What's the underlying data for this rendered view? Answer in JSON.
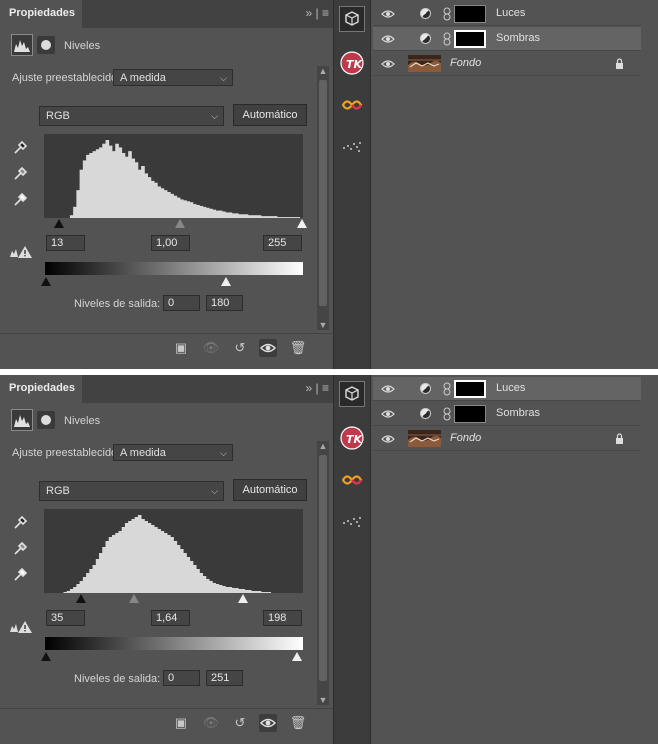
{
  "panels": [
    {
      "tab_title": "Propiedades",
      "adjustment_name": "Niveles",
      "preset_label": "Ajuste preestablecido:",
      "preset_value": "A medida",
      "channel": "RGB",
      "auto_label": "Automático",
      "input_levels": {
        "black": "13",
        "gamma": "1,00",
        "white": "255"
      },
      "output_label": "Niveles de salida:",
      "output_levels": {
        "black": "0",
        "white": "180"
      },
      "histogram": [
        0,
        0,
        0,
        0,
        0,
        0,
        0,
        0,
        3,
        12,
        30,
        52,
        62,
        68,
        70,
        72,
        74,
        76,
        80,
        84,
        78,
        72,
        80,
        76,
        70,
        66,
        72,
        64,
        60,
        52,
        56,
        48,
        44,
        40,
        38,
        34,
        32,
        30,
        28,
        26,
        24,
        22,
        20,
        19,
        18,
        17,
        15,
        14,
        13,
        12,
        11,
        10,
        9,
        8,
        8,
        7,
        6,
        6,
        5,
        5,
        4,
        4,
        4,
        3,
        3,
        3,
        3,
        2,
        2,
        2,
        2,
        2,
        1,
        1,
        1,
        1,
        1,
        1,
        1,
        0
      ],
      "layers": [
        {
          "name": "Luces",
          "type": "adjustment",
          "selected": false
        },
        {
          "name": "Sombras",
          "type": "adjustment",
          "selected": true
        },
        {
          "name": "Fondo",
          "type": "background",
          "selected": false
        }
      ]
    },
    {
      "tab_title": "Propiedades",
      "adjustment_name": "Niveles",
      "preset_label": "Ajuste preestablecido:",
      "preset_value": "A medida",
      "channel": "RGB",
      "auto_label": "Automático",
      "input_levels": {
        "black": "35",
        "gamma": "1,64",
        "white": "198"
      },
      "output_label": "Niveles de salida:",
      "output_levels": {
        "black": "0",
        "white": "251"
      },
      "histogram": [
        0,
        0,
        0,
        0,
        0,
        0,
        1,
        2,
        4,
        6,
        9,
        12,
        16,
        20,
        24,
        28,
        34,
        40,
        46,
        52,
        56,
        58,
        60,
        62,
        66,
        70,
        72,
        74,
        76,
        78,
        74,
        72,
        70,
        68,
        66,
        64,
        62,
        60,
        58,
        56,
        52,
        48,
        44,
        40,
        36,
        32,
        28,
        24,
        20,
        17,
        14,
        12,
        10,
        9,
        8,
        7,
        6,
        6,
        5,
        5,
        4,
        4,
        3,
        3,
        2,
        2,
        2,
        1,
        1,
        1,
        0,
        0,
        0,
        0,
        0,
        0,
        0,
        0,
        0,
        0
      ],
      "layers": [
        {
          "name": "Luces",
          "type": "adjustment",
          "selected": true
        },
        {
          "name": "Sombras",
          "type": "adjustment",
          "selected": false
        },
        {
          "name": "Fondo",
          "type": "background",
          "selected": false
        }
      ]
    }
  ],
  "icons": {
    "tab_menu": "double-chevron-and-hamburger-icon",
    "levels": "histogram-icon",
    "mask": "mask-icon",
    "eyedropper": "eyedropper-icon",
    "clip": "clip-to-layer-icon",
    "view_previous": "view-previous-icon",
    "reset": "reset-icon",
    "visibility": "eye-icon",
    "delete": "trash-icon",
    "lock": "lock-icon"
  },
  "colors": {
    "panel_bg": "#535353",
    "histogram_bg": "#3a3a3a",
    "histogram_fill": "#d8d8d8",
    "selected_layer": "#646464",
    "tk_badge": "#c0394a"
  }
}
